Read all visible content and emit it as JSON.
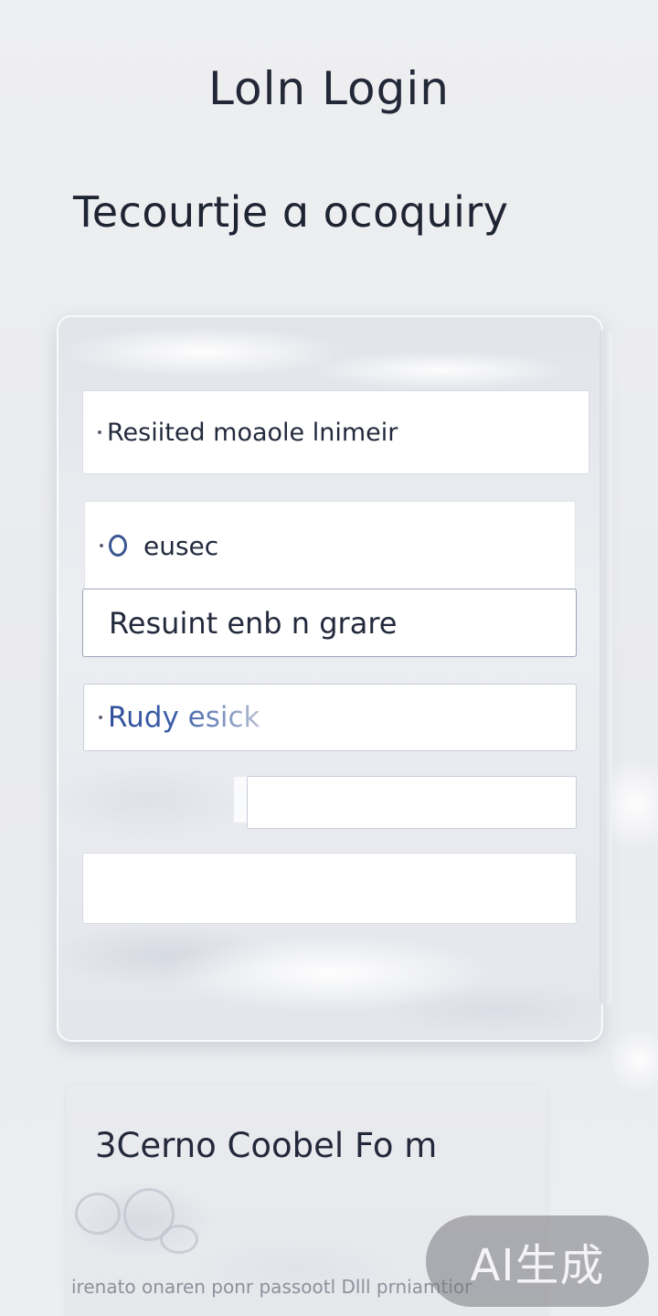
{
  "header": {
    "title": "Loln  Login",
    "subtitle": "Tecourtje ɑ ocoquiry"
  },
  "form": {
    "field1_text": "Resiited moaole lnimeir",
    "field2_icon": "circle-icon",
    "field2_text": "eusec",
    "field3_text": "Resuint enb n grare",
    "field4_text": "Rudy esick",
    "field5_value": "",
    "field6_value": ""
  },
  "secondary_card": {
    "title": "3Cerno Coobel Fo m",
    "footer_text": "irenato onaren ponr passootl Dlll prniamtior"
  },
  "watermark": {
    "label": "AI生成"
  },
  "colors": {
    "background": "#ECEDF0",
    "text_primary": "#232838",
    "field_border": "#C7CCD8",
    "accent_blue": "#3A5690"
  }
}
